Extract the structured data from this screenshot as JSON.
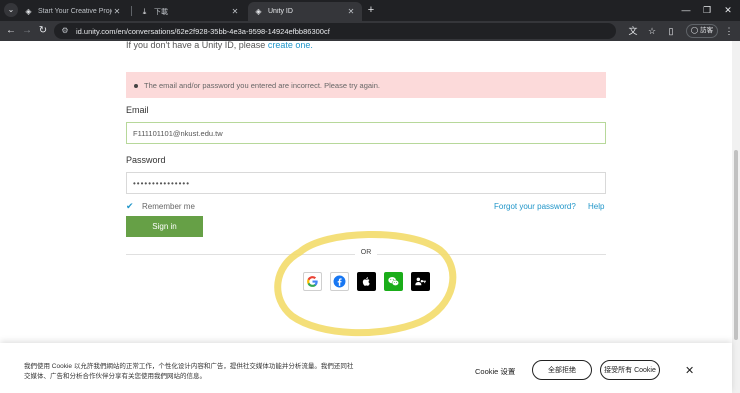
{
  "browser": {
    "tabs": [
      {
        "title": "Start Your Creative Projects a",
        "favicon": "unity-icon",
        "active": false
      },
      {
        "title": "下載",
        "favicon": "download-icon",
        "active": false
      },
      {
        "title": "Unity ID",
        "favicon": "unity-icon",
        "active": true
      }
    ],
    "url": "id.unity.com/en/conversations/62e2f928-35bb-4e3a-9598-14924efbb86300cf",
    "profile_label": "訪客"
  },
  "page": {
    "signup_prefix": "If you don't have a Unity ID, please",
    "signup_link": "create one.",
    "error_message": "The email and/or password you entered are incorrect. Please try again.",
    "email_label": "Email",
    "email_value": "F111101101@nkust.edu.tw",
    "password_label": "Password",
    "password_value": "•••••••••••••••",
    "remember_label": "Remember me",
    "remember_checked": true,
    "forgot_label": "Forgot your password?",
    "help_label": "Help",
    "signin_label": "Sign in",
    "or_label": "OR",
    "social_providers": [
      "google",
      "facebook",
      "apple",
      "wechat",
      "sso"
    ]
  },
  "cookie": {
    "text": "我們使用 Cookie 以允許我們網站的正常工作，个性化设计内容和广告，提供社交媒体功能并分析流量。我們还同社交媒体、广告和分析合作伙伴分享有关您使用我們网站的信息。",
    "settings_label": "Cookie 设置",
    "reject_label": "全部拒绝",
    "accept_label": "接受所有 Cookie"
  },
  "colors": {
    "accent_blue": "#2196c9",
    "signin_green": "#66a046",
    "error_bg": "#fcdada",
    "highlight_yellow": "#f3dc6a"
  }
}
